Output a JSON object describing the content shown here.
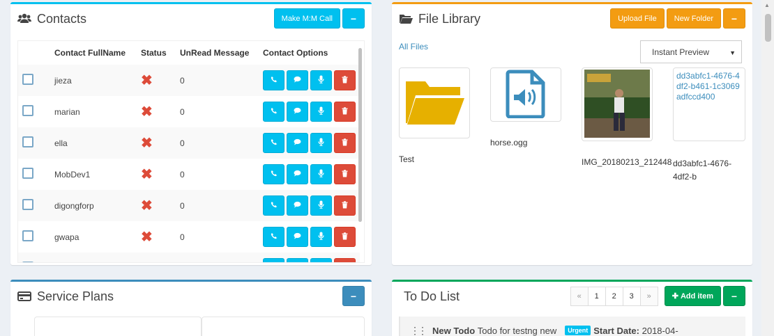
{
  "contacts": {
    "title": "Contacts",
    "make_call_label": "Make M:M Call",
    "minimize_label": "−",
    "columns": [
      "Contact FullName",
      "Status",
      "UnRead Message",
      "Contact Options"
    ],
    "rows": [
      {
        "name": "jieza",
        "unread": "0"
      },
      {
        "name": "marian",
        "unread": "0"
      },
      {
        "name": "ella",
        "unread": "0"
      },
      {
        "name": "MobDev1",
        "unread": "0"
      },
      {
        "name": "digongforp",
        "unread": "0"
      },
      {
        "name": "gwapa",
        "unread": "0"
      }
    ],
    "status_icon": "offline-x-icon"
  },
  "file_library": {
    "title": "File Library",
    "upload_label": "Upload File",
    "new_folder_label": "New Folder",
    "minimize_label": "−",
    "all_files_link": "All Files",
    "preview_select": "Instant Preview",
    "files": [
      {
        "name": "Test",
        "icon": "folder-icon"
      },
      {
        "name": "horse.ogg",
        "icon": "audio-file-icon"
      },
      {
        "name": "IMG_20180213_212448",
        "icon": "image-thumbnail"
      },
      {
        "name": "dd3abfc1-4676-4df2-b",
        "alt": "dd3abfc1-4676-4df2-b461-1c3069adfccd400"
      }
    ]
  },
  "service_plans": {
    "title": "Service Plans",
    "minimize_label": "−"
  },
  "todo": {
    "title": "To Do List",
    "pager": [
      "«",
      "1",
      "2",
      "3",
      "»"
    ],
    "add_label": "Add item",
    "minimize_label": "−",
    "item": {
      "title": "New Todo",
      "text": "Todo for testng new",
      "badge": "Urgent",
      "start_label": "Start Date:",
      "start_value": "2018-04-"
    }
  },
  "colors": {
    "info": "#00c0ef",
    "warning": "#f39c12",
    "danger": "#dd4b39",
    "primary": "#3c8dbc",
    "success": "#00a65a"
  }
}
